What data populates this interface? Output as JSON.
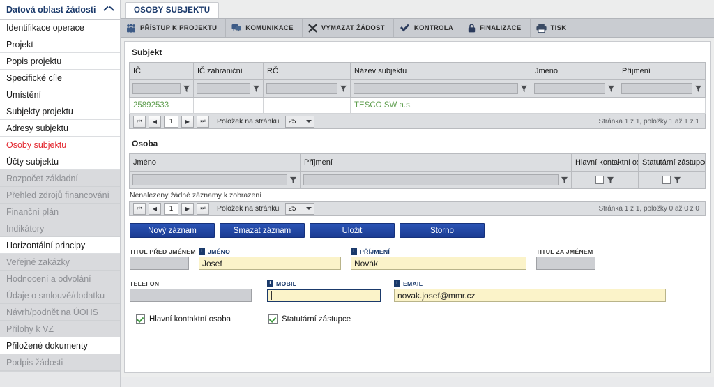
{
  "sidebar": {
    "header": "Datová oblast žádosti",
    "items": [
      {
        "label": "Identifikace operace",
        "state": "normal"
      },
      {
        "label": "Projekt",
        "state": "normal"
      },
      {
        "label": "Popis projektu",
        "state": "normal"
      },
      {
        "label": "Specifické cíle",
        "state": "normal"
      },
      {
        "label": "Umístění",
        "state": "normal"
      },
      {
        "label": "Subjekty projektu",
        "state": "normal"
      },
      {
        "label": "Adresy subjektu",
        "state": "normal"
      },
      {
        "label": "Osoby subjektu",
        "state": "active"
      },
      {
        "label": "Účty subjektu",
        "state": "normal"
      },
      {
        "label": "Rozpočet základní",
        "state": "disabled"
      },
      {
        "label": "Přehled zdrojů financování",
        "state": "disabled"
      },
      {
        "label": "Finanční plán",
        "state": "disabled"
      },
      {
        "label": "Indikátory",
        "state": "disabled"
      },
      {
        "label": "Horizontální principy",
        "state": "normal"
      },
      {
        "label": "Veřejné zakázky",
        "state": "disabled"
      },
      {
        "label": "Hodnocení a odvolání",
        "state": "disabled"
      },
      {
        "label": "Údaje o smlouvě/dodatku",
        "state": "disabled"
      },
      {
        "label": "Návrh/podnět na ÚOHS",
        "state": "disabled"
      },
      {
        "label": "Přílohy k VZ",
        "state": "disabled"
      },
      {
        "label": "Přiložené dokumenty",
        "state": "normal"
      },
      {
        "label": "Podpis žádosti",
        "state": "disabled"
      }
    ]
  },
  "tab": {
    "label": "OSOBY SUBJEKTU"
  },
  "toolbar": {
    "items": [
      {
        "label": "PŘÍSTUP K PROJEKTU",
        "icon": "people-group-icon"
      },
      {
        "label": "KOMUNIKACE",
        "icon": "speech-bubbles-icon"
      },
      {
        "label": "VYMAZAT ŽÁDOST",
        "icon": "x-cross-icon"
      },
      {
        "label": "KONTROLA",
        "icon": "checkmark-icon"
      },
      {
        "label": "FINALIZACE",
        "icon": "lock-icon"
      },
      {
        "label": "TISK",
        "icon": "printer-icon"
      }
    ]
  },
  "subject_section": {
    "title": "Subjekt",
    "columns": [
      "IČ",
      "IČ zahraniční",
      "RČ",
      "Název subjektu",
      "Jméno",
      "Příjmení"
    ],
    "rows": [
      {
        "ic": "25892533",
        "ic_zahranicni": "",
        "rc": "",
        "nazev": "TESCO SW a.s.",
        "jmeno": "",
        "prijmeni": ""
      }
    ],
    "pager": {
      "first": "⏮",
      "prev": "◀",
      "current": "1",
      "next": "▶",
      "last": "⏭",
      "per_page_label": "Položek na stránku",
      "per_page_value": "25",
      "info": "Stránka 1 z 1, položky 1 až 1 z 1"
    }
  },
  "person_section": {
    "title": "Osoba",
    "columns": [
      "Jméno",
      "Příjmení",
      "Hlavní kontaktní osoba",
      "Statutární zástupce"
    ],
    "empty_message": "Nenalezeny žádné záznamy k zobrazení",
    "pager": {
      "first": "⏮",
      "prev": "◀",
      "current": "1",
      "next": "▶",
      "last": "⏭",
      "per_page_label": "Položek na stránku",
      "per_page_value": "25",
      "info": "Stránka 1 z 1, položky 0 až 0 z 0"
    }
  },
  "buttons": {
    "new_record": "Nový záznam",
    "delete_record": "Smazat záznam",
    "save": "Uložit",
    "cancel": "Storno"
  },
  "form": {
    "title_before": {
      "label": "TITUL PŘED JMÉNEM",
      "value": "",
      "required": false
    },
    "first_name": {
      "label": "JMÉNO",
      "value": "Josef",
      "required": true
    },
    "last_name": {
      "label": "PŘÍJMENÍ",
      "value": "Novák",
      "required": true
    },
    "title_after": {
      "label": "TITUL ZA JMÉNEM",
      "value": "",
      "required": false
    },
    "phone": {
      "label": "TELEFON",
      "value": "",
      "required": false
    },
    "mobile": {
      "label": "MOBIL",
      "value": "",
      "required": true
    },
    "email": {
      "label": "EMAIL",
      "value": "novak.josef@mmr.cz",
      "required": true
    },
    "checkboxes": [
      {
        "label": "Hlavní kontaktní osoba",
        "checked": true
      },
      {
        "label": "Statutární zástupce",
        "checked": true
      }
    ]
  },
  "colors": {
    "accent_blue": "#1b3a6b",
    "button_blue": "#1b3c93",
    "active_red": "#e3262e",
    "link_green": "#5f9e4f",
    "field_yellow": "#fbf3c9"
  }
}
